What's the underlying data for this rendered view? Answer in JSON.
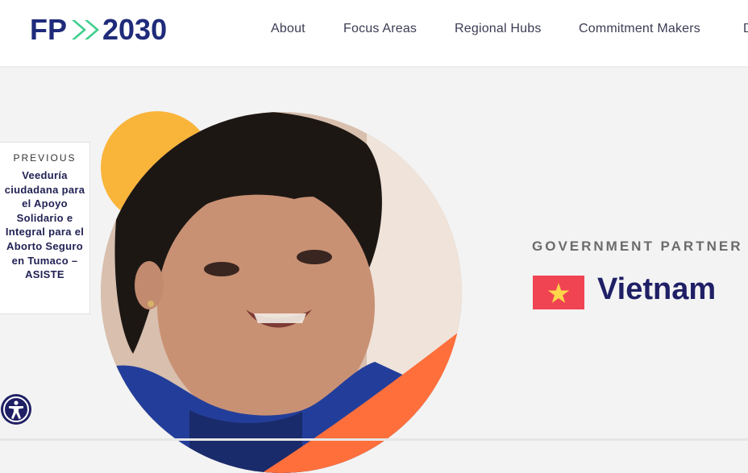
{
  "logo": {
    "text": "FP2030",
    "left": "FP",
    "right": "2030",
    "colors": {
      "navy": "#1f2b7a",
      "green": "#3ecf8e"
    }
  },
  "nav": [
    {
      "label": "About"
    },
    {
      "label": "Focus Areas"
    },
    {
      "label": "Regional Hubs"
    },
    {
      "label": "Commitment Makers"
    },
    {
      "label": "D"
    }
  ],
  "previous": {
    "eyebrow": "PREVIOUS",
    "title": "Veeduría ciudadana para el Apoyo Solidario e Integral para el Aborto Seguro en Tumaco – ASISTE"
  },
  "profile": {
    "eyebrow": "GOVERNMENT PARTNER",
    "country": "Vietnam",
    "flag": {
      "icon": "vietnam-flag-icon",
      "bg": "#f04452",
      "star": "#ffd54a"
    }
  },
  "colors": {
    "yellow_blob": "#f9b43a",
    "orange_wedge": "#ff6f3c",
    "navy": "#1f1f66"
  },
  "a11y": {
    "icon": "accessibility-icon"
  }
}
